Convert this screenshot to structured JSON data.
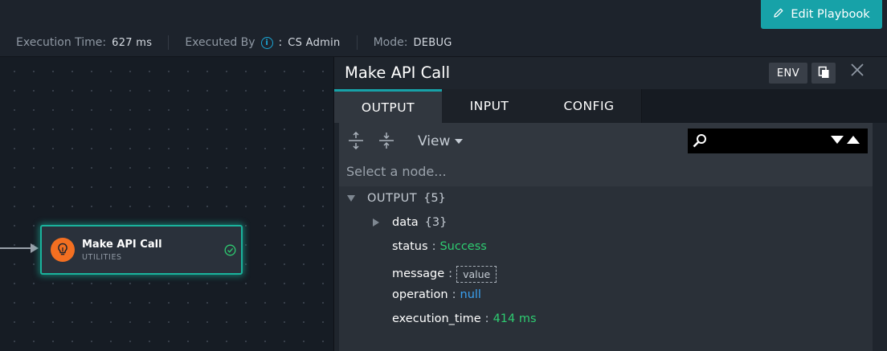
{
  "header": {
    "edit_label": "Edit Playbook"
  },
  "info": {
    "execution_time_label": "Execution Time:",
    "execution_time_value": "627 ms",
    "executed_by_label": "Executed By",
    "executed_by_value": "CS Admin",
    "mode_label": "Mode:",
    "mode_value": "DEBUG"
  },
  "node": {
    "title": "Make API Call",
    "subtitle": "UTILITIES"
  },
  "panel": {
    "title": "Make API Call",
    "env_label": "ENV",
    "tabs": [
      {
        "label": "OUTPUT",
        "active": true
      },
      {
        "label": "INPUT",
        "active": false
      },
      {
        "label": "CONFIG",
        "active": false
      }
    ],
    "view_label": "View",
    "path_placeholder": "Select a node..."
  },
  "tree": {
    "root_key": "OUTPUT",
    "root_count": "{5}",
    "data_key": "data",
    "data_count": "{3}",
    "rows": [
      {
        "key": "status",
        "value": "Success"
      },
      {
        "key": "message",
        "value": "value"
      },
      {
        "key": "operation",
        "value": "null"
      },
      {
        "key": "execution_time",
        "value": "414 ms"
      }
    ]
  },
  "colors": {
    "accent": "#17a2a8",
    "node_border": "#1ab39c",
    "node_icon": "#f36f21",
    "success": "#2ecc71",
    "null": "#3aa0f0"
  },
  "icons": [
    "pencil-icon",
    "info-icon",
    "lightbulb-icon",
    "check-circle-icon",
    "copy-icon",
    "close-icon",
    "expand-all-icon",
    "collapse-all-icon",
    "search-icon"
  ]
}
